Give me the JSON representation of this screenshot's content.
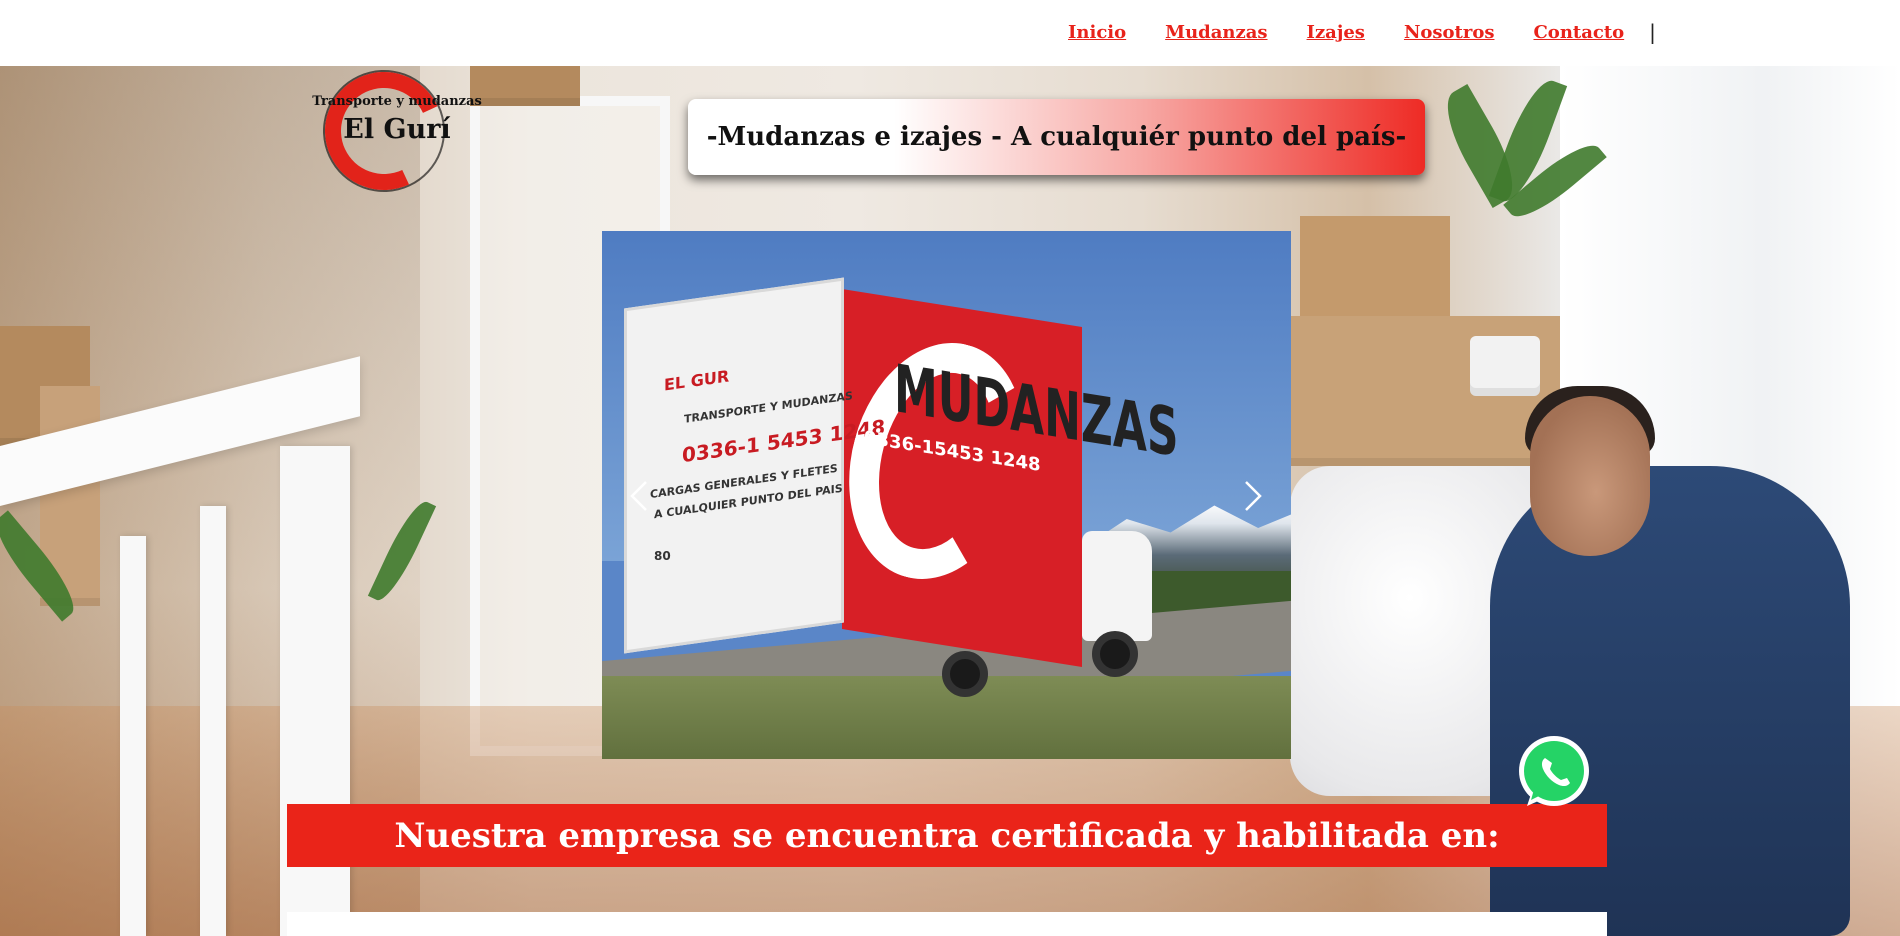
{
  "nav": {
    "items": [
      "Inicio",
      "Mudanzas",
      "Izajes",
      "Nosotros",
      "Contacto"
    ],
    "separator": "|"
  },
  "logo": {
    "top_text": "Transporte y mudanzas",
    "main_text": "El Gurí",
    "icon": "red-crescent-logo-icon"
  },
  "hero": {
    "headline": "-Mudanzas e izajes - A cualquiér punto del país-"
  },
  "carousel": {
    "prev_icon": "chevron-left-icon",
    "next_icon": "chevron-right-icon",
    "slide": {
      "back_brand": "EL GUR",
      "back_subtitle": "TRANSPORTE Y MUDANZAS",
      "back_phone": "0336-1 5453 1248",
      "back_line1": "CARGAS GENERALES Y FLETES",
      "back_line2": "A CUALQUIER PUNTO DEL PAIS",
      "side_title": "MUDANZAS",
      "side_phone": "0336-15453 1248",
      "plate_number": "80"
    }
  },
  "certification": {
    "text": "Nuestra empresa se encuentra certificada y habilitada en:"
  },
  "whatsapp": {
    "icon": "whatsapp-icon"
  },
  "colors": {
    "accent": "#e8231b",
    "banner_red": "#ea2419",
    "whatsapp_green": "#25d366"
  }
}
